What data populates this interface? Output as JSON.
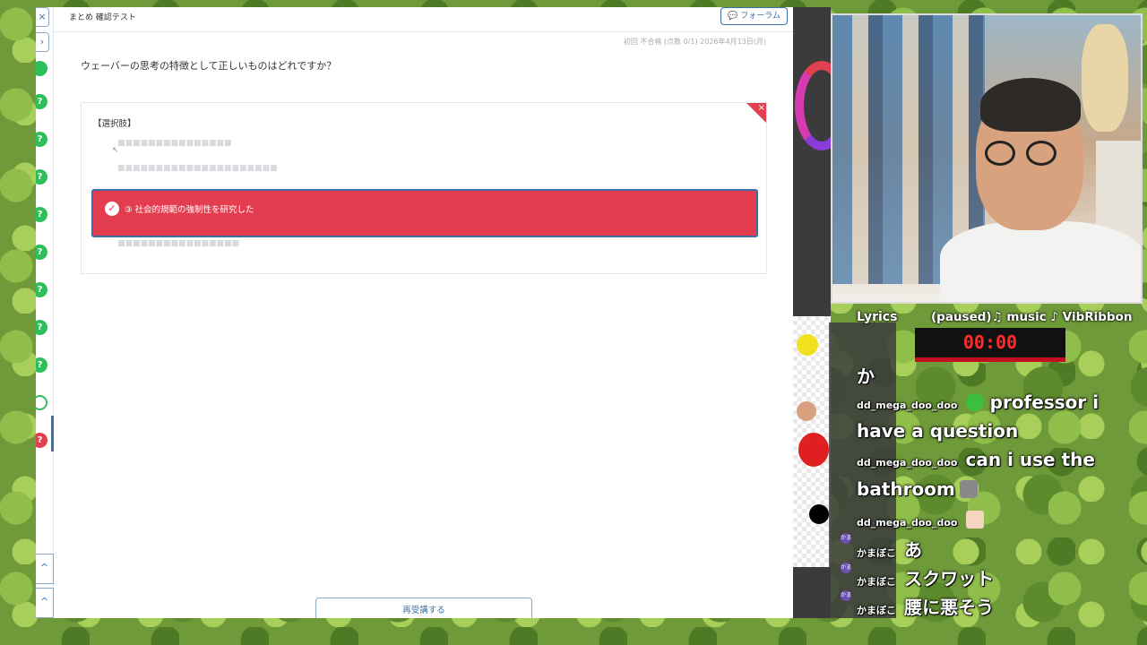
{
  "lms": {
    "breadcrumb": "まとめ 確認テスト",
    "forum_label": "フォーラム",
    "meta": "初回 不合格 (点数 0/1) 2026年4月13日(月)",
    "question": "ウェーバーの思考の特徴として正しいものはどれですか？",
    "choices_title": "【選択肢】",
    "selected_choice": "③ 社会的規範の強制性を研究した",
    "retake_label": "再受講する",
    "close_glyph": "×",
    "check_glyph": "✓"
  },
  "rail": {
    "collapse_glyph": "×",
    "expand_glyph": "›",
    "chevron_up_glyph": "^",
    "status_pass_glyph": "?",
    "status_fail_glyph": "?"
  },
  "stream": {
    "lyrics_label": "Lyrics",
    "music_label": "(paused)♫ music ♪ VibRibbon",
    "timer": "00:00",
    "chat": [
      {
        "user": "",
        "text": "か"
      },
      {
        "user": "dd_mega_doo_doo",
        "text": "professor i"
      },
      {
        "user": "",
        "text": "have a question"
      },
      {
        "user": "dd_mega_doo_doo",
        "text": "can i use the"
      },
      {
        "user": "",
        "text": "bathroom"
      },
      {
        "user": "dd_mega_doo_doo",
        "text": ""
      },
      {
        "user": "かまぼこ",
        "text": "あ"
      },
      {
        "user": "かまぼこ",
        "text": "スクワット"
      },
      {
        "user": "かまぼこ",
        "text": "腰に悪そう"
      }
    ],
    "badge_label": "かま"
  },
  "colors": {
    "accent_blue": "#3b6fa6",
    "incorrect_red": "#e53d50",
    "pass_green": "#2fbf5a"
  }
}
